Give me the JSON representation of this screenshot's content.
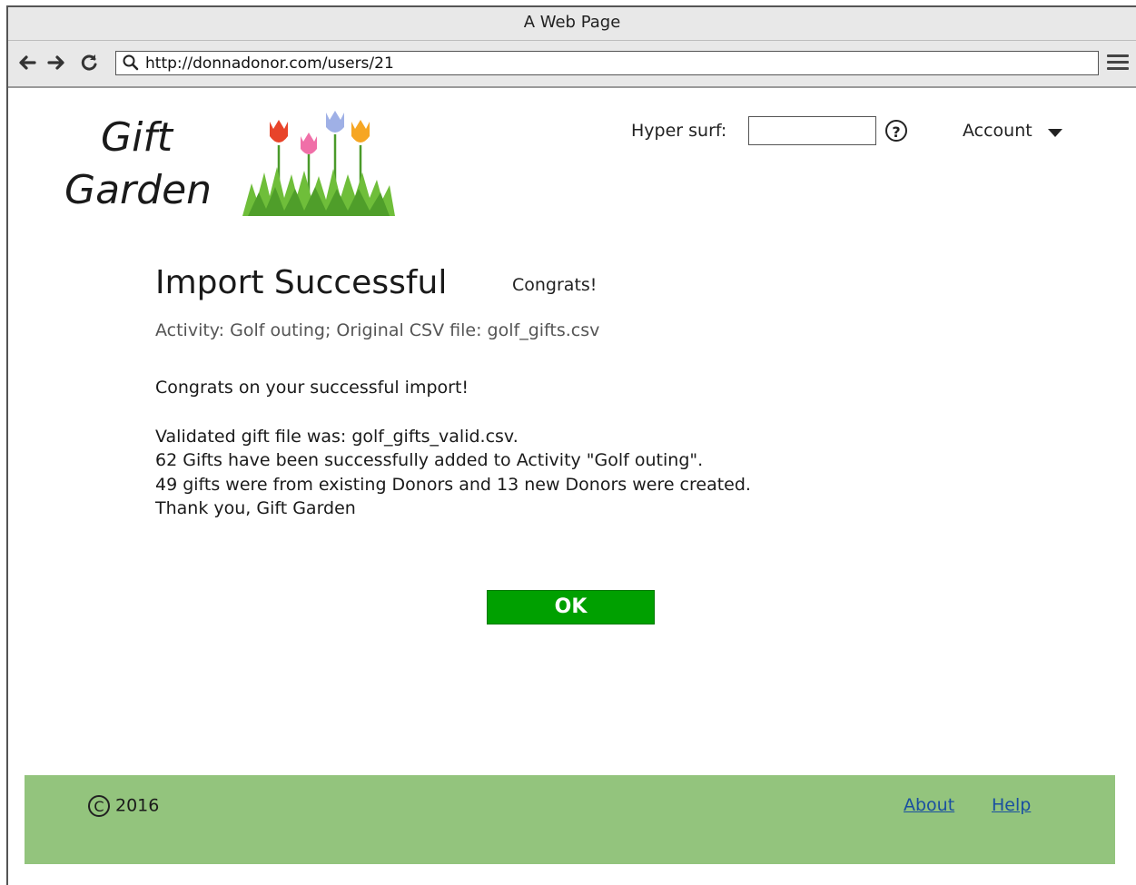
{
  "browser": {
    "title": "A Web Page",
    "url": "http://donnadonor.com/users/21"
  },
  "logo": {
    "line1": "Gift",
    "line2": "Garden",
    "colors": {
      "tulip_red": "#e8442a",
      "tulip_pink": "#f06fa8",
      "tulip_blue": "#9fb0e6",
      "tulip_orange": "#f6a623",
      "grass": "#6fbe3a"
    }
  },
  "header": {
    "search_label": "Hyper surf:",
    "search_value": "",
    "help_icon": "?",
    "account_label": "Account"
  },
  "main": {
    "title": "Import Successful",
    "congrats_tag": "Congrats!",
    "subline": "Activity: Golf outing; Original CSV file: golf_gifts.csv",
    "message_intro": "Congrats on your successful import!",
    "message_lines": [
      "Validated gift file was: golf_gifts_valid.csv.",
      "62 Gifts have been successfully added to Activity \"Golf outing\".",
      "49 gifts were from existing Donors and 13 new Donors were created.",
      "Thank you, Gift Garden"
    ],
    "ok_label": "OK",
    "ok_color": "#00a000"
  },
  "footer": {
    "copyright_symbol": "C",
    "year": "2016",
    "links": [
      "About",
      "Help"
    ],
    "bg_color": "#93c47d"
  }
}
